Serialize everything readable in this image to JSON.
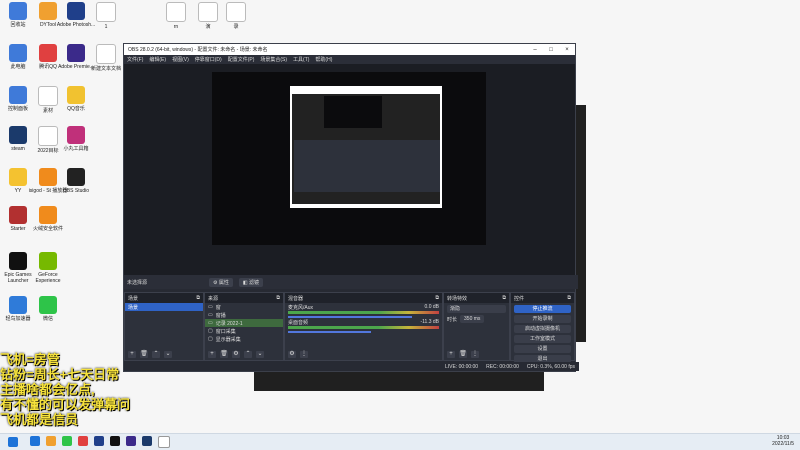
{
  "desktop_icons": [
    {
      "label": "回收站",
      "color": "#3f7ad9"
    },
    {
      "label": "DYTool",
      "color": "#f0a030"
    },
    {
      "label": "Adobe Photosh...",
      "color": "#1f3f8a"
    },
    {
      "label": "1",
      "color": "#ffffff"
    },
    {
      "label": "rn",
      "color": "#ffffff"
    },
    {
      "label": "演",
      "color": "#ffffff"
    },
    {
      "label": "录",
      "color": "#ffffff"
    },
    {
      "label": "此电脑",
      "color": "#3f7ad9"
    },
    {
      "label": "腾讯QQ",
      "color": "#e04040"
    },
    {
      "label": "Adobe Premie...",
      "color": "#3b2a8a"
    },
    {
      "label": "新建文本文档",
      "color": "#ffffff"
    },
    {
      "label": "控制面板",
      "color": "#3f7ad9"
    },
    {
      "label": "素材",
      "color": "#ffffff"
    },
    {
      "label": "QQ音乐",
      "color": "#f1c230"
    },
    {
      "label": "steam",
      "color": "#1b3a6b"
    },
    {
      "label": "2022目标",
      "color": "#ffffff"
    },
    {
      "label": "小丸工具箱",
      "color": "#c0307a"
    },
    {
      "label": "YY",
      "color": "#f4c230"
    },
    {
      "label": "isigod - St 播放器",
      "color": "#f08b1c"
    },
    {
      "label": "OBS Studio",
      "color": "#222222"
    },
    {
      "label": "Starter",
      "color": "#b23030"
    },
    {
      "label": "火绒安全软件",
      "color": "#f08b1c"
    },
    {
      "label": "Epic Games Launcher",
      "color": "#111111"
    },
    {
      "label": "GeForce Experience",
      "color": "#76b900"
    },
    {
      "label": "轻鸟加速器",
      "color": "#2f7bd9"
    },
    {
      "label": "微信",
      "color": "#2ec449"
    }
  ],
  "obs": {
    "title": "OBS 28.0.2 (64-bit, windows) - 配置文件: 未命名 - 场景: 未命名",
    "menu": [
      "文件(F)",
      "编辑(E)",
      "视图(V)",
      "停靠窗口(D)",
      "配置文件(P)",
      "场景集合(S)",
      "工具(T)",
      "帮助(H)"
    ],
    "no_source": "未选择源",
    "properties_btn": "属性",
    "filters_btn": "滤镜",
    "scenes": {
      "title": "场景",
      "items": [
        "场景"
      ]
    },
    "sources": {
      "title": "来源",
      "items": [
        "窗",
        "窗播",
        "记录 2022-1",
        "窗口采集",
        "显示器采集"
      ]
    },
    "mixer": {
      "title": "混音器",
      "tracks": [
        {
          "name": "麦克风/Aux",
          "db": "0.0 dB",
          "level": 0.82
        },
        {
          "name": "桌面音频",
          "db": "-11.3 dB",
          "level": 0.55
        }
      ]
    },
    "transitions": {
      "title": "转场特效",
      "type": "渐隐",
      "duration_label": "时长",
      "duration": "350 ms"
    },
    "controls": {
      "title": "控件",
      "buttons": [
        "停止推流",
        "开始录制",
        "启动虚拟摄像机",
        "工作室模式",
        "设置",
        "退出"
      ]
    },
    "status": {
      "live": "LIVE: 00:00:00",
      "rec": "REC: 00:00:00",
      "cpu": "CPU: 0.3%, 60.00 fps"
    }
  },
  "danmu": [
    "飞机=房管",
    "钻粉=周长+七天日常",
    "主播啥都会亿点,",
    "有不懂的可以发弹幕问",
    "飞机都是信员"
  ],
  "taskbar": {
    "time": "10:03",
    "date": "2022/11/5",
    "icons": [
      "#1e73d8",
      "#f0a030",
      "#2ec449",
      "#e04040",
      "#1f3f8a",
      "#111111",
      "#3b2a8a",
      "#1b3a6b",
      "#ffffff"
    ]
  }
}
